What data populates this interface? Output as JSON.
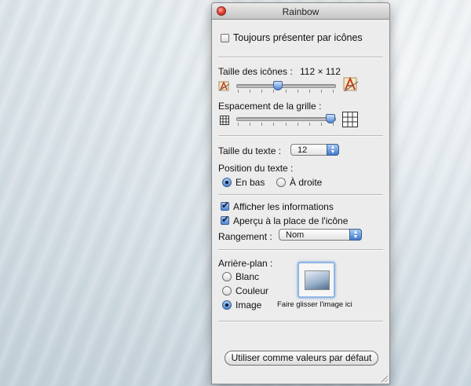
{
  "window": {
    "title": "Rainbow"
  },
  "icon_view": {
    "always_icons_label": "Toujours présenter par icônes",
    "always_icons_checked": false,
    "icon_size_label": "Taille des icônes :",
    "icon_size_value": "112 × 112",
    "icon_size_fraction": 0.42,
    "grid_spacing_label": "Espacement de la grille :",
    "grid_spacing_fraction": 1.0
  },
  "text": {
    "text_size_label": "Taille du texte :",
    "text_size_value": "12",
    "text_position_label": "Position du texte :",
    "position_options": [
      {
        "label": "En bas",
        "selected": true
      },
      {
        "label": "À droite",
        "selected": false
      }
    ]
  },
  "options": {
    "show_info_label": "Afficher les informations",
    "show_info_checked": true,
    "preview_label": "Aperçu à la place de l'icône",
    "preview_checked": true,
    "arrange_label": "Rangement :",
    "arrange_value": "Nom"
  },
  "background": {
    "label": "Arrière-plan :",
    "options": [
      {
        "label": "Blanc",
        "selected": false
      },
      {
        "label": "Couleur",
        "selected": false
      },
      {
        "label": "Image",
        "selected": true
      }
    ],
    "drop_hint": "Faire glisser l'image ici"
  },
  "footer": {
    "defaults_button": "Utiliser comme valeurs par défaut"
  },
  "icons": {
    "close": "close-button",
    "small_icon": "app-icon-small",
    "large_icon": "app-icon-large",
    "small_grid": "grid-small-icon",
    "large_grid": "grid-large-icon",
    "popup_arrows": "updown-arrows-icon"
  },
  "colors": {
    "accent": "#4d86d6",
    "close": "#e8453a",
    "panel": "#ececec"
  }
}
